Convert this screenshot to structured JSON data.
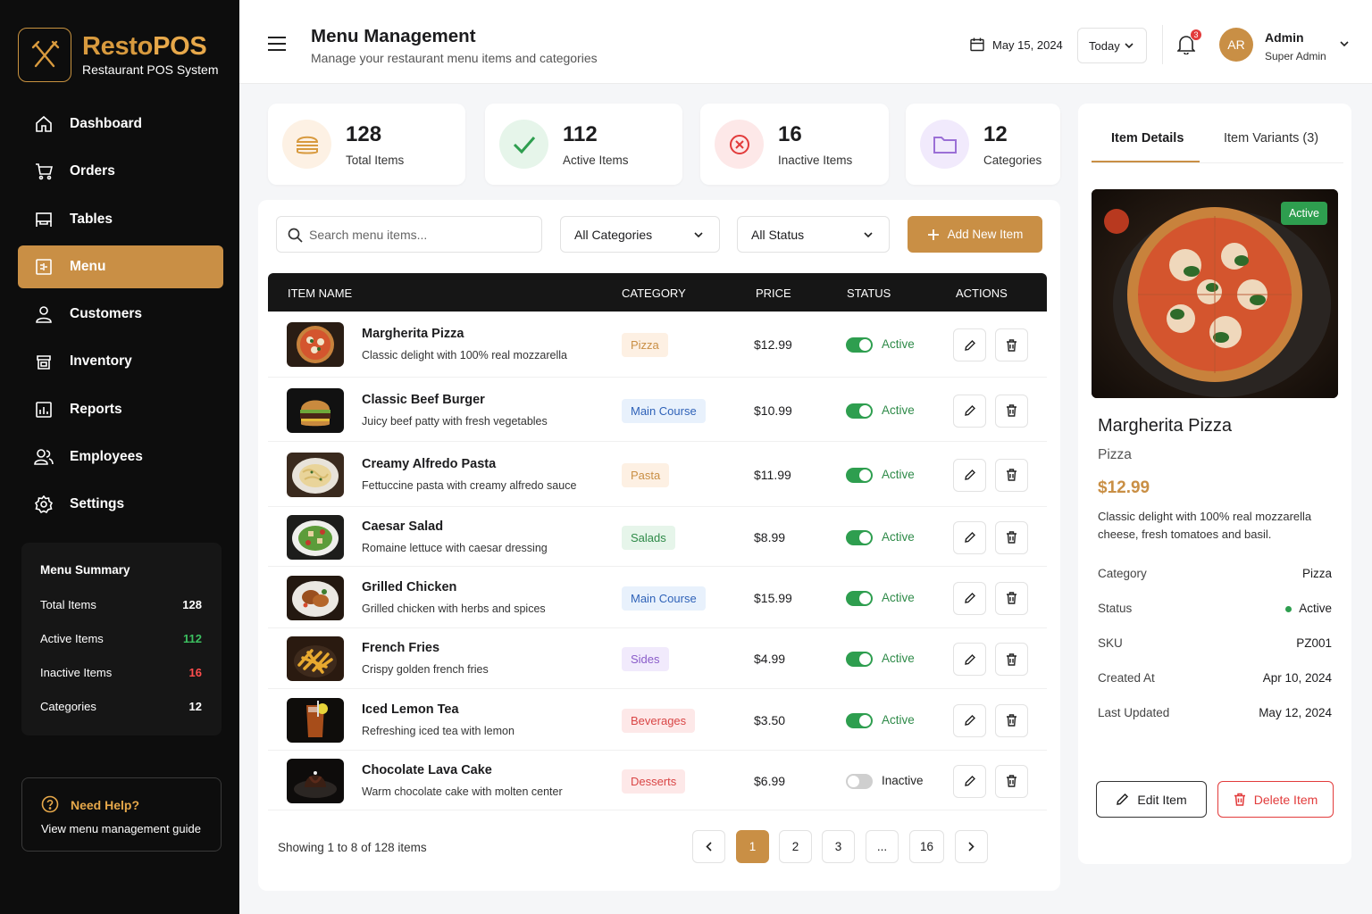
{
  "brand": {
    "name_part1": "Resto",
    "name_part2": "POS",
    "subtitle": "Restaurant POS System"
  },
  "nav": [
    {
      "label": "Dashboard",
      "icon": "home-icon"
    },
    {
      "label": "Orders",
      "icon": "cart-icon"
    },
    {
      "label": "Tables",
      "icon": "table-icon"
    },
    {
      "label": "Menu",
      "icon": "menu-book-icon",
      "active": true
    },
    {
      "label": "Customers",
      "icon": "user-icon"
    },
    {
      "label": "Inventory",
      "icon": "box-icon"
    },
    {
      "label": "Reports",
      "icon": "report-icon"
    },
    {
      "label": "Employees",
      "icon": "users-icon"
    },
    {
      "label": "Settings",
      "icon": "gear-icon"
    }
  ],
  "summary": {
    "title": "Menu Summary",
    "rows": [
      {
        "label": "Total Items",
        "value": "128",
        "color": "#ffffff"
      },
      {
        "label": "Active Items",
        "value": "112",
        "color": "#3cc060"
      },
      {
        "label": "Inactive Items",
        "value": "16",
        "color": "#ff4d4d"
      },
      {
        "label": "Categories",
        "value": "12",
        "color": "#ffffff"
      }
    ]
  },
  "help": {
    "title": "Need Help?",
    "desc": "View menu management guide"
  },
  "header": {
    "title": "Menu Management",
    "subtitle": "Manage your restaurant menu items and categories",
    "date": "May 15, 2024",
    "range": "Today",
    "notifications": "3",
    "user_initials": "AR",
    "user_name": "Admin",
    "user_role": "Super Admin"
  },
  "stats": [
    {
      "value": "128",
      "label": "Total Items",
      "icon": "burger-icon",
      "bg": "#fdf1e4",
      "fg": "#d89a3e"
    },
    {
      "value": "112",
      "label": "Active Items",
      "icon": "check-icon",
      "bg": "#e6f5ea",
      "fg": "#2e9e4f"
    },
    {
      "value": "16",
      "label": "Inactive Items",
      "icon": "x-circle-icon",
      "bg": "#fde8e8",
      "fg": "#e23b3b"
    },
    {
      "value": "12",
      "label": "Categories",
      "icon": "folder-icon",
      "bg": "#f1eafc",
      "fg": "#9b6fd6"
    }
  ],
  "filters": {
    "search_placeholder": "Search menu items...",
    "category": "All Categories",
    "status": "All Status",
    "add_label": "Add New Item"
  },
  "table": {
    "headers": [
      "ITEM NAME",
      "CATEGORY",
      "PRICE",
      "STATUS",
      "ACTIONS"
    ],
    "rows": [
      {
        "name": "Margherita Pizza",
        "desc": "Classic delight with 100% real mozzarella",
        "category": "Pizza",
        "cat_bg": "#fdf0e3",
        "cat_fg": "#c98f45",
        "price": "$12.99",
        "status": "Active",
        "on": true
      },
      {
        "name": "Classic Beef Burger",
        "desc": "Juicy beef patty with fresh vegetables",
        "category": "Main Course",
        "cat_bg": "#e8f1fc",
        "cat_fg": "#2f62b8",
        "price": "$10.99",
        "status": "Active",
        "on": true
      },
      {
        "name": "Creamy Alfredo Pasta",
        "desc": "Fettuccine pasta with creamy alfredo sauce",
        "category": "Pasta",
        "cat_bg": "#fdf0e3",
        "cat_fg": "#c98f45",
        "price": "$11.99",
        "status": "Active",
        "on": true
      },
      {
        "name": "Caesar Salad",
        "desc": "Romaine lettuce with caesar dressing",
        "category": "Salads",
        "cat_bg": "#e6f5ea",
        "cat_fg": "#2e8a48",
        "price": "$8.99",
        "status": "Active",
        "on": true
      },
      {
        "name": "Grilled Chicken",
        "desc": "Grilled chicken with herbs and spices",
        "category": "Main Course",
        "cat_bg": "#e8f1fc",
        "cat_fg": "#2f62b8",
        "price": "$15.99",
        "status": "Active",
        "on": true
      },
      {
        "name": "French Fries",
        "desc": "Crispy golden french fries",
        "category": "Sides",
        "cat_bg": "#f1eafc",
        "cat_fg": "#8a5cc9",
        "price": "$4.99",
        "status": "Active",
        "on": true
      },
      {
        "name": "Iced Lemon Tea",
        "desc": "Refreshing iced tea with lemon",
        "category": "Beverages",
        "cat_bg": "#fde8e8",
        "cat_fg": "#d94545",
        "price": "$3.50",
        "status": "Active",
        "on": true
      },
      {
        "name": "Chocolate Lava Cake",
        "desc": "Warm chocolate cake with molten center",
        "category": "Desserts",
        "cat_bg": "#fde8e8",
        "cat_fg": "#d94545",
        "price": "$6.99",
        "status": "Inactive",
        "on": false
      }
    ]
  },
  "pagination": {
    "showing": "Showing 1 to 8 of 128 items",
    "pages": [
      "1",
      "2",
      "3",
      "...",
      "16"
    ],
    "current": "1"
  },
  "detail": {
    "tab1": "Item Details",
    "tab2": "Item Variants (3)",
    "badge": "Active",
    "name": "Margherita Pizza",
    "category": "Pizza",
    "price": "$12.99",
    "desc": "Classic delight with 100% real mozzarella cheese, fresh tomatoes and basil.",
    "fields": [
      {
        "k": "Category",
        "v": "Pizza"
      },
      {
        "k": "Status",
        "v": "Active"
      },
      {
        "k": "SKU",
        "v": "PZ001"
      },
      {
        "k": "Created At",
        "v": "Apr 10, 2024"
      },
      {
        "k": "Last Updated",
        "v": "May 12, 2024"
      }
    ],
    "edit_label": "Edit Item",
    "delete_label": "Delete Item"
  }
}
